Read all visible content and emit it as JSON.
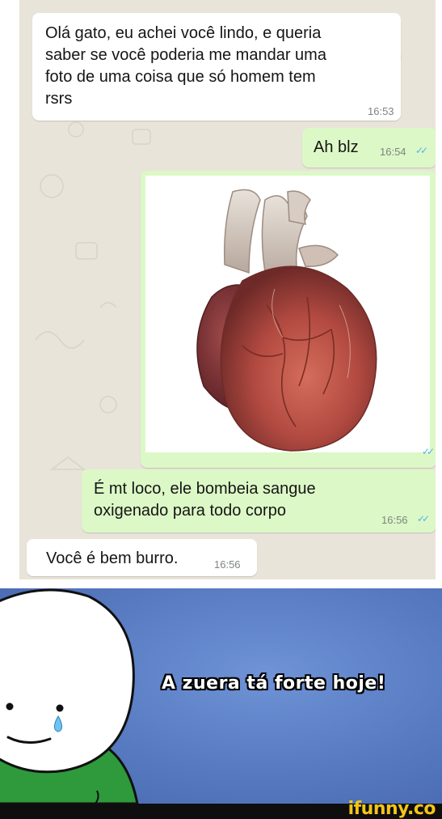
{
  "chat": {
    "messages": [
      {
        "direction": "incoming",
        "text_lines": [
          "Olá gato, eu achei você lindo, e queria",
          "saber se você poderia me mandar uma",
          "foto de uma coisa que só homem tem",
          "rsrs"
        ],
        "time": "16:53"
      },
      {
        "direction": "outgoing",
        "text": "Ah blz",
        "time": "16:54",
        "ticks": "✓✓"
      },
      {
        "direction": "outgoing",
        "type": "image",
        "image_alt": "anatomical-heart",
        "ticks": "✓✓"
      },
      {
        "direction": "outgoing",
        "text_lines": [
          "É mt loco, ele bombeia sangue",
          "oxigenado para todo corpo"
        ],
        "time": "16:56",
        "ticks": "✓✓"
      },
      {
        "direction": "incoming",
        "text": "Você é bem burro.",
        "time": "16:56"
      }
    ]
  },
  "meme": {
    "caption": "A zuera tá forte hoje!"
  },
  "watermark": "ifunny.co",
  "colors": {
    "chat_bg": "#e9e4d9",
    "incoming_bubble": "#ffffff",
    "outgoing_bubble": "#dcf8c6",
    "read_ticks": "#4fb3e8",
    "meme_bg": "#5a7fc4",
    "watermark": "#f4c518"
  }
}
